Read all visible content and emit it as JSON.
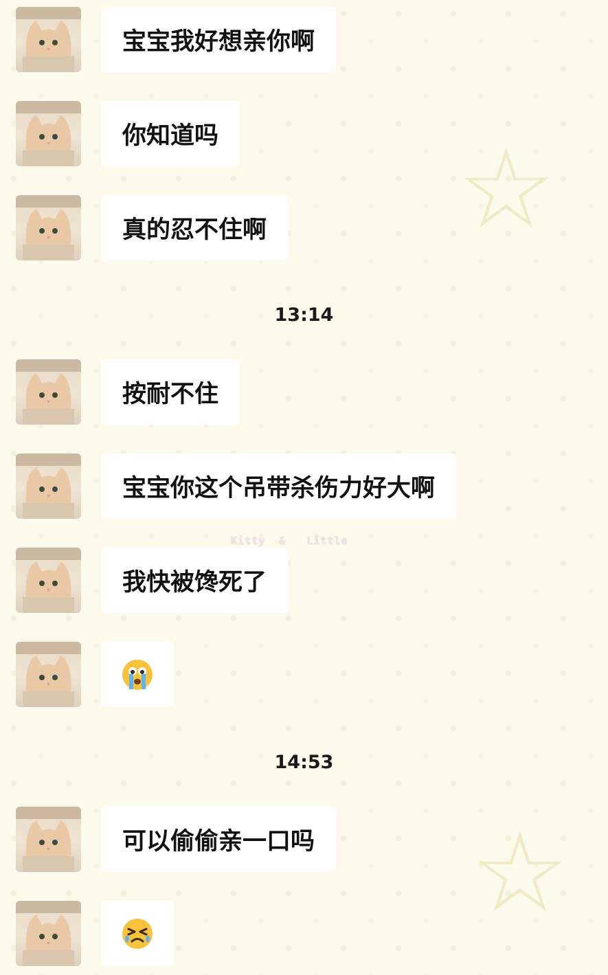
{
  "chat": {
    "messages": [
      {
        "text": "宝宝我好想亲你啊",
        "type": "text"
      },
      {
        "text": "你知道吗",
        "type": "text"
      },
      {
        "text": "真的忍不住啊",
        "type": "text"
      },
      {
        "text": "按耐不住",
        "type": "text"
      },
      {
        "text": "宝宝你这个吊带杀伤力好大啊",
        "type": "text"
      },
      {
        "text": "我快被馋死了",
        "type": "text"
      },
      {
        "text": "😭",
        "type": "emoji",
        "icon": "crying-face-icon"
      },
      {
        "text": "可以偷偷亲一口吗",
        "type": "text"
      },
      {
        "text": "😣",
        "type": "emoji",
        "icon": "persevering-face-icon"
      }
    ],
    "timestamps": [
      "13:14",
      "14:53"
    ]
  },
  "watermark": {
    "text": "Kitty  &   Little"
  },
  "colors": {
    "background": "#fbfaeb",
    "bubble": "#ffffff",
    "text": "#111111"
  }
}
